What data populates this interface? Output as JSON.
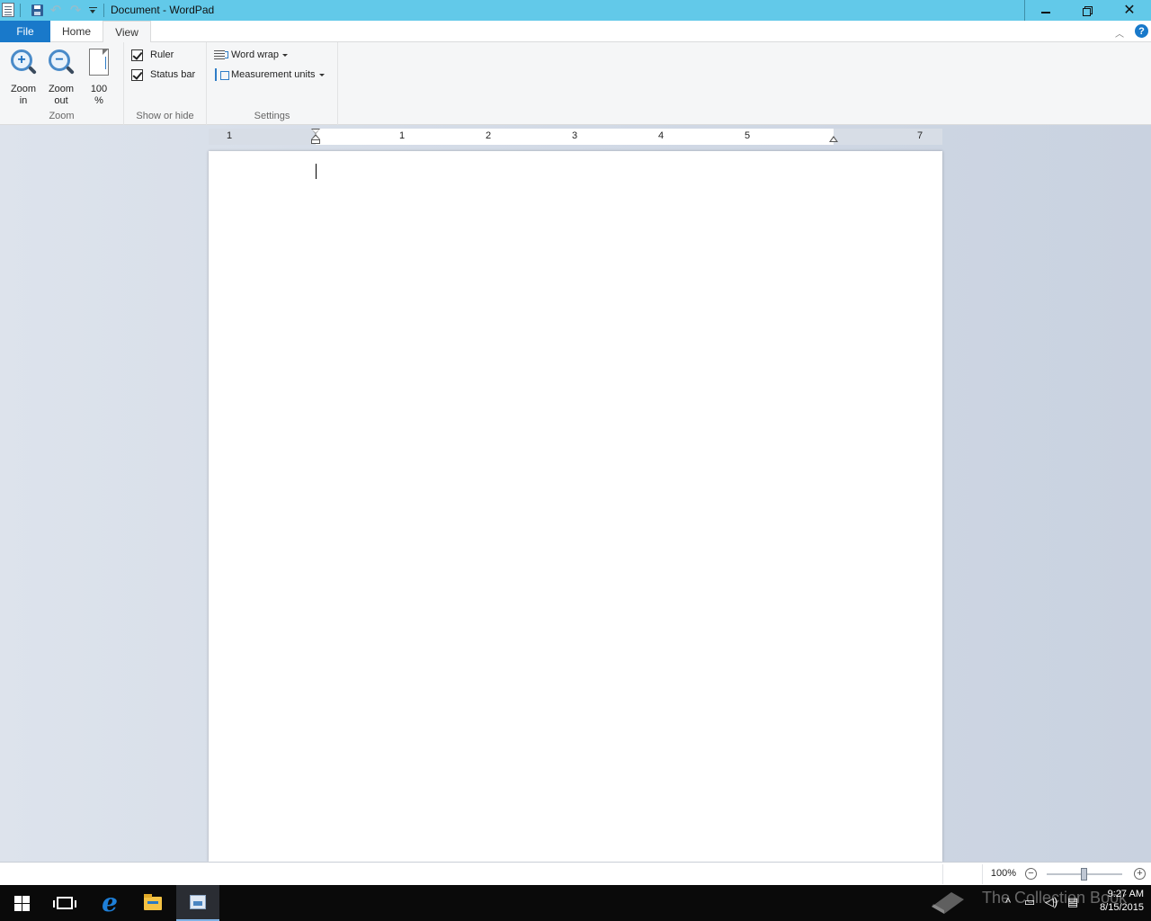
{
  "window": {
    "title": "Document - WordPad"
  },
  "ribbon": {
    "tabs": [
      {
        "label": "File"
      },
      {
        "label": "Home"
      },
      {
        "label": "View"
      }
    ],
    "active_tab": "View",
    "groups": {
      "zoom": {
        "label": "Zoom",
        "zoom_in": {
          "line1": "Zoom",
          "line2": "in",
          "icon": "zoom-in-icon"
        },
        "zoom_out": {
          "line1": "Zoom",
          "line2": "out",
          "icon": "zoom-out-icon"
        },
        "hundred": {
          "line1": "100",
          "line2": "%",
          "icon": "page-100-icon"
        }
      },
      "show_hide": {
        "label": "Show or hide",
        "ruler": {
          "label": "Ruler",
          "checked": true
        },
        "status_bar": {
          "label": "Status bar",
          "checked": true
        }
      },
      "settings": {
        "label": "Settings",
        "word_wrap": {
          "label": "Word wrap"
        },
        "measurement_units": {
          "label": "Measurement units"
        }
      }
    },
    "help_label": "?"
  },
  "ruler": {
    "numbers": [
      "1",
      "1",
      "2",
      "3",
      "4",
      "5",
      "7"
    ]
  },
  "document": {
    "content": ""
  },
  "statusbar": {
    "zoom_percent": "100%",
    "zoom_out_label": "−",
    "zoom_in_label": "+",
    "zoom_level_fraction": 0.5
  },
  "taskbar": {
    "clock_time": "9:27 AM",
    "clock_date": "8/15/2015",
    "watermark": "The Collection Book"
  },
  "colors": {
    "titlebar": "#62c9e9",
    "file_tab": "#1979ca",
    "taskbar": "#0a0a0a"
  }
}
